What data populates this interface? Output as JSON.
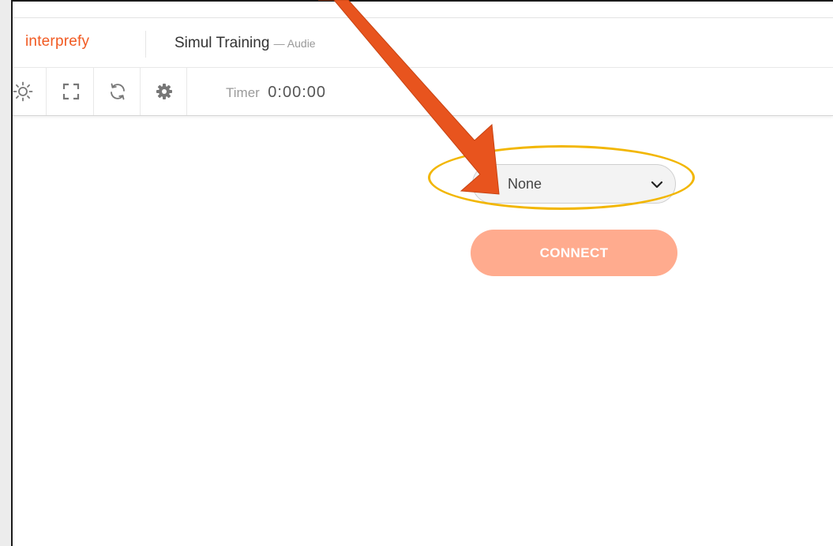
{
  "header": {
    "logo_text": "interprefy",
    "title": "Simul Training",
    "subtitle": "— Audie"
  },
  "toolbar": {
    "icons": [
      "brightness-icon",
      "fullscreen-icon",
      "refresh-icon",
      "settings-gear-icon"
    ],
    "timer_label": "Timer",
    "timer_value": "0:00:00"
  },
  "channel_select": {
    "selected_value": "None"
  },
  "connect_button": {
    "label": "CONNECT"
  },
  "colors": {
    "brand_orange": "#f15a22",
    "connect_button_bg": "#ffab8e",
    "highlight_ring": "#f2b600",
    "arrow": "#e8541e"
  }
}
